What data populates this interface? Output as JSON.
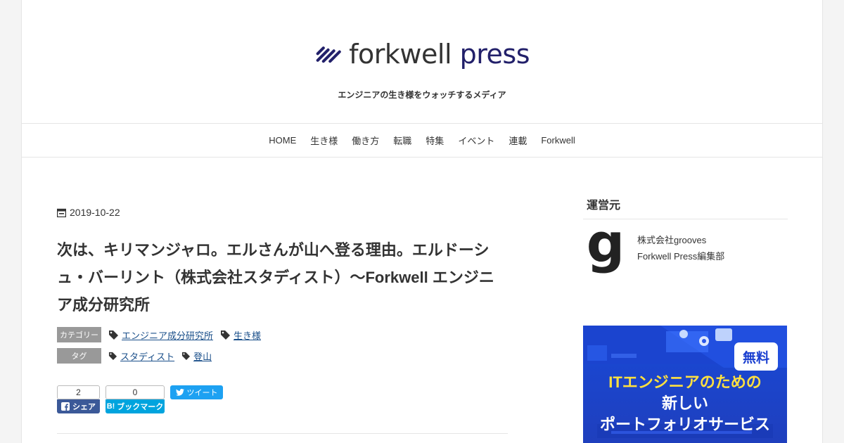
{
  "site": {
    "logo_name": "forkwell",
    "logo_sub": "press",
    "tagline": "エンジニアの生き様をウォッチするメディア"
  },
  "nav": [
    "HOME",
    "生き様",
    "働き方",
    "転職",
    "特集",
    "イベント",
    "連載",
    "Forkwell"
  ],
  "article": {
    "date": "2019-10-22",
    "title": "次は、キリマンジャロ。エルさんが山へ登る理由。エルドーシュ・バーリント（株式会社スタディスト）～Forkwell エンジニア成分研究所",
    "category_label": "カテゴリー",
    "categories": [
      "エンジニア成分研究所",
      "生き様"
    ],
    "tag_label": "タグ",
    "tags": [
      "スタディスト",
      "登山"
    ]
  },
  "share": {
    "facebook_count": "2",
    "facebook_label": "シェア",
    "hatena_count": "0",
    "hatena_label": "ブックマーク",
    "tweet_label": "ツイート"
  },
  "sidebar": {
    "title": "運営元",
    "avatar_letter": "g",
    "company": "株式会社grooves",
    "dept": "Forkwell Press編集部",
    "banner": {
      "badge": "無料",
      "line1": "ITエンジニアのための",
      "line2": "新しい",
      "line3": "ポートフォリオサービス"
    }
  },
  "colors": {
    "brand": "#22206a",
    "facebook": "#3b5998",
    "hatena": "#00a4de",
    "twitter": "#1da1f2",
    "banner": "#1849d8"
  }
}
